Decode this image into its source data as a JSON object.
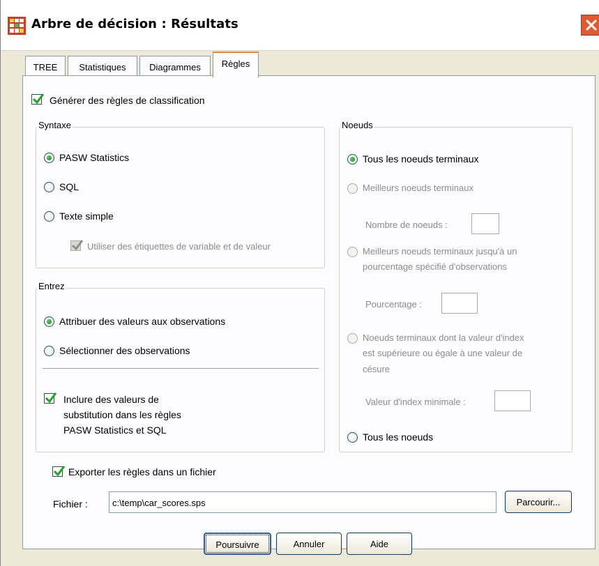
{
  "window": {
    "title": "Arbre de décision : Résultats"
  },
  "tabs": [
    {
      "label": "TREE"
    },
    {
      "label": "Statistiques"
    },
    {
      "label": "Diagrammes"
    },
    {
      "label": "Règles",
      "active": true
    }
  ],
  "rules": {
    "generate_label": "Générer des règles de classification",
    "generate_checked": true
  },
  "syntax": {
    "legend": "Syntaxe",
    "options": [
      {
        "label": "PASW Statistics",
        "selected": true
      },
      {
        "label": "SQL",
        "selected": false
      },
      {
        "label": "Texte simple",
        "selected": false
      }
    ],
    "use_labels": "Utiliser des étiquettes de variable et de valeur"
  },
  "enter": {
    "legend": "Entrez",
    "options": [
      {
        "label": "Attribuer des valeurs aux observations",
        "selected": true
      },
      {
        "label": "Sélectionner des observations",
        "selected": false
      }
    ],
    "include_line1": "Inclure des valeurs de",
    "include_line2": "substitution dans les règles",
    "include_line3": "PASW Statistics et SQL"
  },
  "nodes": {
    "legend": "Noeuds",
    "all_terminal": "Tous les noeuds terminaux",
    "best_terminal": "Meilleurs noeuds terminaux",
    "count_label": "Nombre de noeuds :",
    "best_pct_line1": "Meilleurs noeuds terminaux jusqu'à un",
    "best_pct_line2": "pourcentage spécifié d'observations",
    "pct_label": "Pourcentage :",
    "index_line1": "Noeuds terminaux dont la valeur d'index",
    "index_line2": "est supérieure ou égale à une valeur de",
    "index_line3": "césure",
    "min_index_label": "Valeur d'index minimale :",
    "all_nodes": "Tous les noeuds"
  },
  "export": {
    "label": "Exporter les règles dans un fichier",
    "checked": true,
    "file_label": "Fichier :",
    "file_value": "c:\\temp\\car_scores.sps",
    "browse": "Parcourir..."
  },
  "buttons": {
    "continue": "Poursuivre",
    "cancel": "Annuler",
    "help": "Aide"
  },
  "colors": {
    "dialog_bg": "#ece9d8",
    "panel_bg": "#fcfcfe",
    "radio_selected": "#21a121",
    "check_mark": "#21a121",
    "close_button": "#e05a30"
  }
}
